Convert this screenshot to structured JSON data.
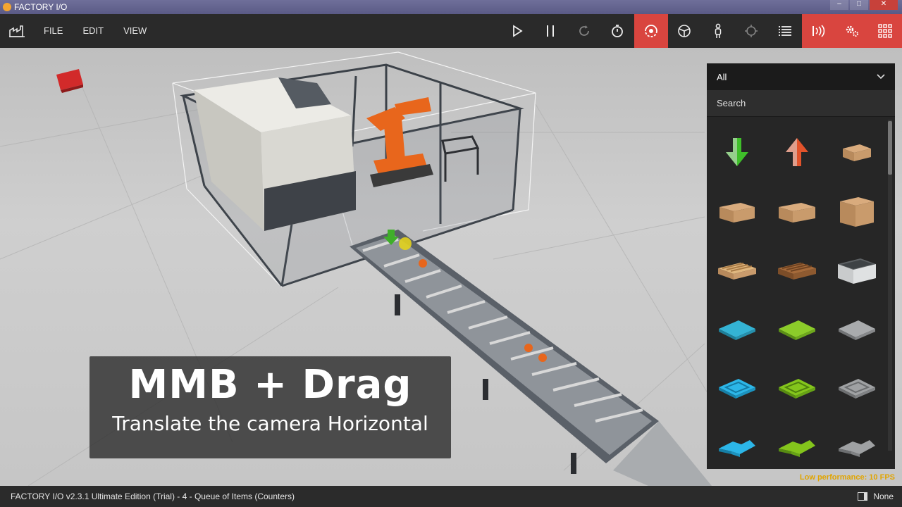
{
  "window": {
    "title": "FACTORY I/O",
    "controls": [
      "minimize-icon",
      "maximize-icon",
      "close-icon"
    ]
  },
  "menu": {
    "items": [
      {
        "id": "file",
        "label": "FILE"
      },
      {
        "id": "edit",
        "label": "EDIT"
      },
      {
        "id": "view",
        "label": "VIEW"
      }
    ]
  },
  "toolbar": {
    "tools": [
      "play-icon",
      "pause-icon",
      "reset-icon",
      "stopwatch-icon",
      "orbit-camera-icon",
      "fly-camera-icon",
      "first-person-icon",
      "target-icon",
      "list-icon",
      "sensor-icon",
      "settings-gears-icon",
      "grid-icon"
    ],
    "accent": "#d9453f"
  },
  "caption": {
    "title": "MMB + Drag",
    "subtitle": "Translate the camera Horizontal"
  },
  "panel": {
    "filter": "All",
    "search_placeholder": "Search",
    "items": [
      "remover",
      "emitter",
      "small-box",
      "medium-box",
      "medium-box-2",
      "large-box",
      "pallet",
      "pallet-2",
      "stackable-box",
      "blue-plate",
      "green-plate",
      "gray-plate",
      "blue-tray",
      "green-tray",
      "gray-tray",
      "blue-lid",
      "green-lid",
      "gray-lid"
    ]
  },
  "performance": "Low performance: 10 FPS",
  "status": {
    "text": "FACTORY I/O v2.3.1 Ultimate Edition (Trial)  - 4 - Queue of Items (Counters)",
    "selection_label": "None"
  }
}
